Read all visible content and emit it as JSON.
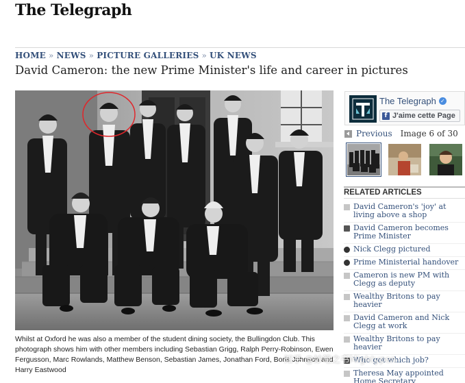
{
  "masthead": {
    "title": "The Telegraph"
  },
  "breadcrumb": {
    "items": [
      "HOME",
      "NEWS",
      "PICTURE GALLERIES",
      "UK NEWS"
    ],
    "separator": "»"
  },
  "page": {
    "title": "David Cameron: the new Prime Minister's life and career in pictures"
  },
  "photo": {
    "caption": "Whilst at Oxford he was also a member of the student dining society, the Bullingdon Club. This photograph shows him with other members including Sebastian Grigg, Ralph Perry-Robinson, Ewen Fergusson, Marc Rowlands, Matthew Benson, Sebastian James, Jonathan Ford, Boris Johnson and Harry Eastwood",
    "highlight_color": "#e0262b"
  },
  "facebook": {
    "page_name": "The Telegraph",
    "like_label": "J'aime cette Page"
  },
  "gallery_nav": {
    "previous_label": "Previous",
    "image_count": "Image 6 of 30"
  },
  "related": {
    "header": "RELATED ARTICLES",
    "items": [
      {
        "text": "David Cameron's 'joy' at living above a shop",
        "icon": "article"
      },
      {
        "text": "David Cameron becomes Prime Minister",
        "icon": "gallery"
      },
      {
        "text": "Nick Clegg pictured",
        "icon": "video"
      },
      {
        "text": "Prime Ministerial handover",
        "icon": "video"
      },
      {
        "text": "Cameron is new PM with Clegg as deputy",
        "icon": "article"
      },
      {
        "text": "Wealthy Britons to pay heavier",
        "icon": "article"
      },
      {
        "text": "David Cameron and Nick Clegg at work",
        "icon": "article"
      },
      {
        "text": "Wealthy Britons to pay heavier",
        "icon": "article"
      },
      {
        "text": "Who got which job?",
        "icon": "gallery"
      },
      {
        "text": "Theresa May appointed Home Secretary",
        "icon": "article"
      }
    ]
  },
  "watermark": {
    "text": "知乎 @妙笔之书Mightypen"
  }
}
